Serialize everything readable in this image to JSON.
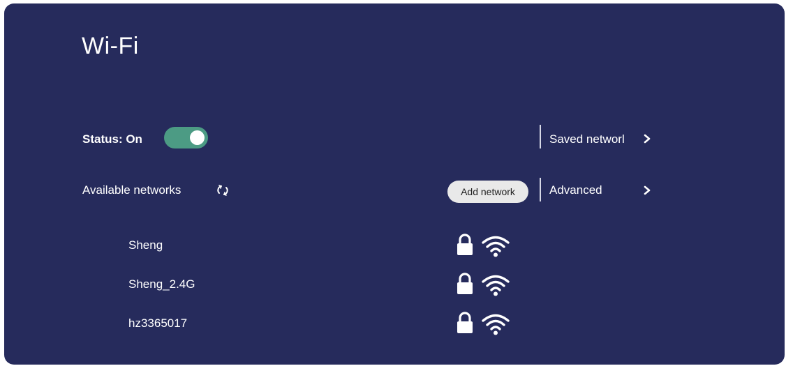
{
  "page": {
    "title": "Wi-Fi"
  },
  "status": {
    "label": "Status: On",
    "enabled": true
  },
  "networks_section": {
    "label": "Available networks",
    "add_button": "Add network"
  },
  "side_links": {
    "saved": "Saved networl",
    "advanced": "Advanced"
  },
  "networks": [
    {
      "ssid": "Sheng",
      "secured": true,
      "signal": "full"
    },
    {
      "ssid": "Sheng_2.4G",
      "secured": true,
      "signal": "full"
    },
    {
      "ssid": "hz3365017",
      "secured": true,
      "signal": "full"
    }
  ],
  "colors": {
    "panel_bg": "#262b5c",
    "toggle_on": "#4c9b84",
    "text": "#ffffff",
    "button_bg": "#e9e9e9"
  },
  "icons": {
    "refresh": "refresh-icon",
    "chevron": "chevron-right-icon",
    "lock": "lock-icon",
    "wifi": "wifi-icon"
  }
}
